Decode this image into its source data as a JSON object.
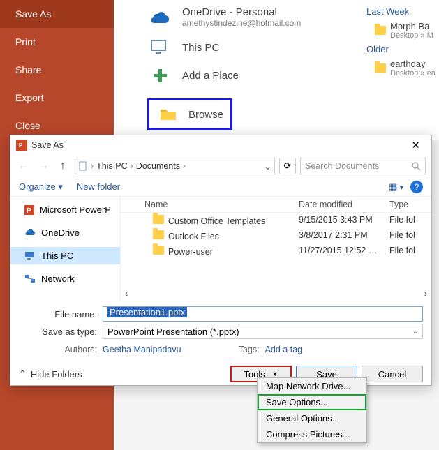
{
  "sidebar": {
    "items": [
      {
        "label": "Save As",
        "active": true
      },
      {
        "label": "Print"
      },
      {
        "label": "Share"
      },
      {
        "label": "Export"
      },
      {
        "label": "Close"
      }
    ]
  },
  "backstage": {
    "onedrive": {
      "title": "OneDrive - Personal",
      "sub": "amethystindezine@hotmail.com"
    },
    "thispc": {
      "title": "This PC"
    },
    "addplace": {
      "title": "Add a Place"
    },
    "browse": {
      "title": "Browse"
    }
  },
  "recent": {
    "heads": [
      "Last Week",
      "Older"
    ],
    "items": [
      {
        "name": "Morph Ba",
        "sub": "Desktop » M"
      },
      {
        "name": "earthday",
        "sub": "Desktop » ea"
      }
    ]
  },
  "dialog": {
    "title": "Save As",
    "breadcrumb": [
      "This PC",
      "Documents"
    ],
    "search_placeholder": "Search Documents",
    "toolbar": {
      "organize": "Organize",
      "newfolder": "New folder"
    },
    "side": [
      {
        "label": "Microsoft PowerP",
        "icon": "pp"
      },
      {
        "label": "OneDrive",
        "icon": "cloud"
      },
      {
        "label": "This PC",
        "icon": "pc",
        "selected": true
      },
      {
        "label": "Network",
        "icon": "net"
      }
    ],
    "columns": {
      "name": "Name",
      "date": "Date modified",
      "type": "Type"
    },
    "rows": [
      {
        "name": "Custom Office Templates",
        "date": "9/15/2015 3:43 PM",
        "type": "File fol"
      },
      {
        "name": "Outlook Files",
        "date": "3/8/2017 2:31 PM",
        "type": "File fol"
      },
      {
        "name": "Power-user",
        "date": "11/27/2015 12:52 …",
        "type": "File fol"
      }
    ],
    "filename_label": "File name:",
    "filename": "Presentation1.pptx",
    "savetype_label": "Save as type:",
    "savetype": "PowerPoint Presentation (*.pptx)",
    "authors_label": "Authors:",
    "authors": "Geetha Manipadavu",
    "tags_label": "Tags:",
    "tags": "Add a tag",
    "hidefolders": "Hide Folders",
    "buttons": {
      "tools": "Tools",
      "save": "Save",
      "cancel": "Cancel"
    }
  },
  "tools_menu": [
    "Map Network Drive...",
    "Save Options...",
    "General Options...",
    "Compress Pictures..."
  ]
}
